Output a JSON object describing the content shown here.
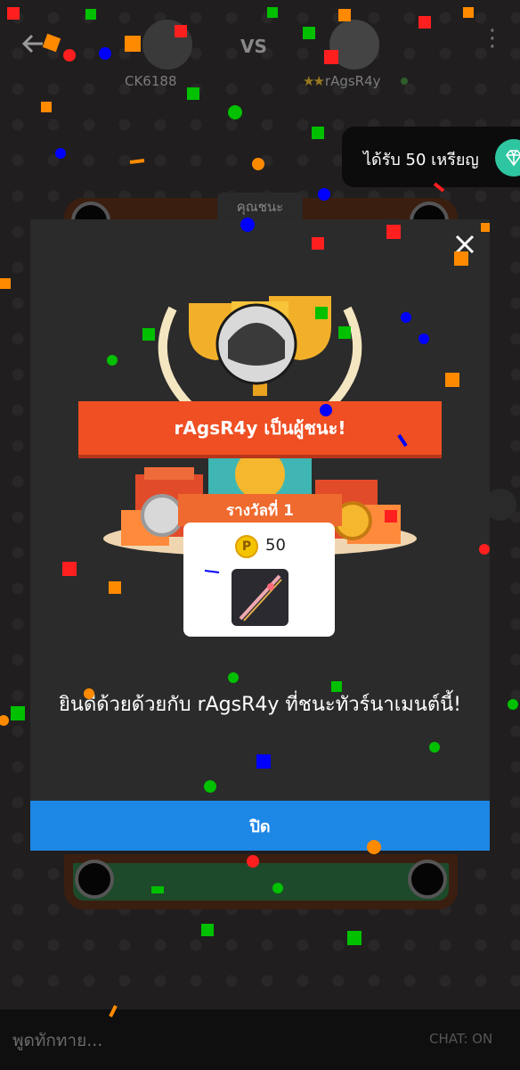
{
  "header": {
    "player1_name": "CK6188",
    "vs_label": "VS",
    "player2_name": "rAgsR4y",
    "player2_stars": "★★"
  },
  "toast": {
    "text": "ได้รับ 50 เหรียญ",
    "icon": "gem-icon"
  },
  "table": {
    "label": "คุณชนะ"
  },
  "modal": {
    "winner_text": "rAgsR4y เป็นผู้ชนะ!",
    "reward_title": "รางวัลที่ 1",
    "coin_symbol": "P",
    "coin_amount": "50",
    "congrats_text": "ยินดีด้วยด้วยกับ rAgsR4y ที่ชนะทัวร์นาเมนต์นี้!",
    "close_label": "ปิด"
  },
  "chat": {
    "placeholder": "พูดทักทาย...",
    "status": "CHAT: ON"
  },
  "colors": {
    "banner": "#ef4f23",
    "button": "#1d87e5",
    "gem": "#2ec6a0",
    "coin": "#f4c400"
  }
}
